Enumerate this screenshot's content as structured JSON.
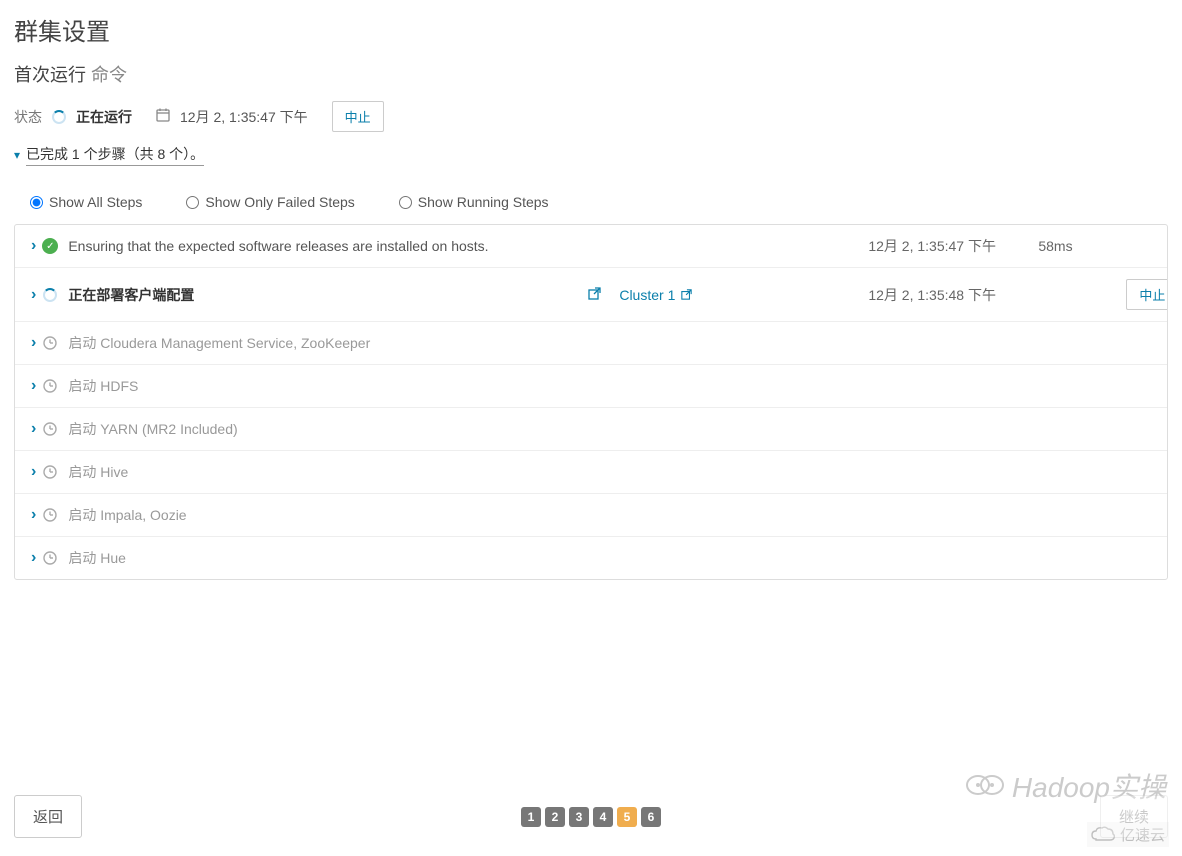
{
  "page_title": "群集设置",
  "subtitle_main": "首次运行",
  "subtitle_light": "命令",
  "status": {
    "label": "状态",
    "text": "正在运行",
    "timestamp": "12月 2, 1:35:47 下午",
    "abort_label": "中止"
  },
  "progress": {
    "text": "已完成 1 个步骤（共 8 个）。"
  },
  "filters": {
    "all": "Show All Steps",
    "failed": "Show Only Failed Steps",
    "running": "Show Running Steps"
  },
  "steps": [
    {
      "status": "success",
      "desc": "Ensuring that the expected software releases are installed on hosts.",
      "bold": false,
      "time": "12月 2, 1:35:47 下午",
      "duration": "58ms",
      "link": "",
      "action": ""
    },
    {
      "status": "running",
      "desc": "正在部署客户端配置",
      "bold": true,
      "time": "12月 2, 1:35:48 下午",
      "duration": "",
      "link": "Cluster 1",
      "action": "中止"
    },
    {
      "status": "pending",
      "desc": "启动 Cloudera Management Service, ZooKeeper",
      "bold": false,
      "time": "",
      "duration": "",
      "link": "",
      "action": ""
    },
    {
      "status": "pending",
      "desc": "启动 HDFS",
      "bold": false,
      "time": "",
      "duration": "",
      "link": "",
      "action": ""
    },
    {
      "status": "pending",
      "desc": "启动 YARN (MR2 Included)",
      "bold": false,
      "time": "",
      "duration": "",
      "link": "",
      "action": ""
    },
    {
      "status": "pending",
      "desc": "启动 Hive",
      "bold": false,
      "time": "",
      "duration": "",
      "link": "",
      "action": ""
    },
    {
      "status": "pending",
      "desc": "启动 Impala, Oozie",
      "bold": false,
      "time": "",
      "duration": "",
      "link": "",
      "action": ""
    },
    {
      "status": "pending",
      "desc": "启动 Hue",
      "bold": false,
      "time": "",
      "duration": "",
      "link": "",
      "action": ""
    }
  ],
  "footer": {
    "back": "返回",
    "continue": "继续",
    "pages": [
      "1",
      "2",
      "3",
      "4",
      "5",
      "6"
    ],
    "active_page": "5"
  },
  "watermark1": "Hadoop实操",
  "watermark2": "亿速云"
}
